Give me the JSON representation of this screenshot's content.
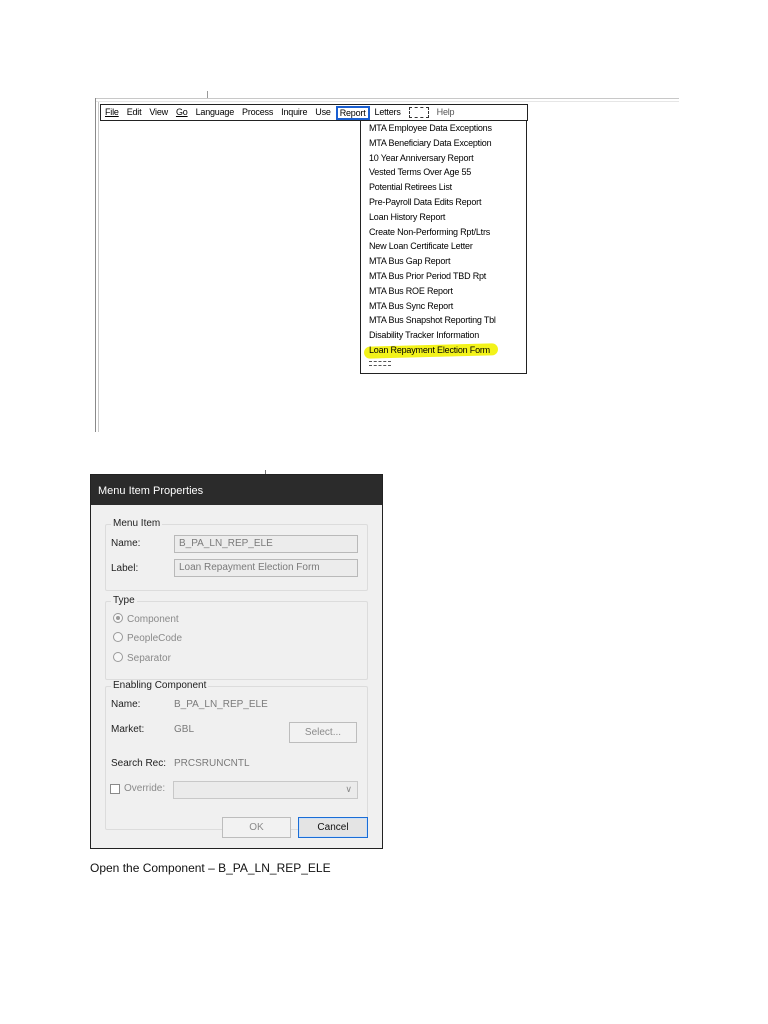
{
  "menu_bar": {
    "items": [
      "File",
      "Edit",
      "View",
      "Go",
      "Language",
      "Process",
      "Inquire",
      "Use",
      "Report",
      "Letters",
      "",
      "Help"
    ],
    "active": "Report"
  },
  "report_menu": {
    "items": [
      "MTA Employee Data Exceptions",
      "MTA Beneficiary Data Exception",
      "10 Year Anniversary Report",
      "Vested Terms Over Age 55",
      "Potential Retirees List",
      "Pre-Payroll Data Edits Report",
      "Loan History Report",
      "Create Non-Performing Rpt/Ltrs",
      "New Loan Certificate Letter",
      "MTA Bus Gap Report",
      "MTA Bus Prior Period TBD Rpt",
      "MTA Bus ROE Report",
      "MTA Bus Sync Report",
      "MTA Bus Snapshot Reporting Tbl",
      "Disability Tracker Information",
      "Loan Repayment Election Form"
    ],
    "highlighted": "Loan Repayment Election Form",
    "highlight_color": "#f3f31a"
  },
  "dialog": {
    "title": "Menu Item Properties",
    "menu_item": {
      "group_label": "Menu Item",
      "name_label": "Name:",
      "name_value": "B_PA_LN_REP_ELE",
      "label_label": "Label:",
      "label_value": "Loan Repayment Election Form"
    },
    "type": {
      "group_label": "Type",
      "options": [
        "Component",
        "PeopleCode",
        "Separator"
      ],
      "selected": "Component"
    },
    "enabling_component": {
      "group_label": "Enabling Component",
      "name_label": "Name:",
      "name_value": "B_PA_LN_REP_ELE",
      "market_label": "Market:",
      "market_value": "GBL",
      "select_button": "Select...",
      "search_rec_label": "Search Rec:",
      "search_rec_value": "PRCSRUNCNTL",
      "override_label": "Override:",
      "override_value": ""
    },
    "ok_button": "OK",
    "cancel_button": "Cancel"
  },
  "caption": "Open the Component – B_PA_LN_REP_ELE"
}
